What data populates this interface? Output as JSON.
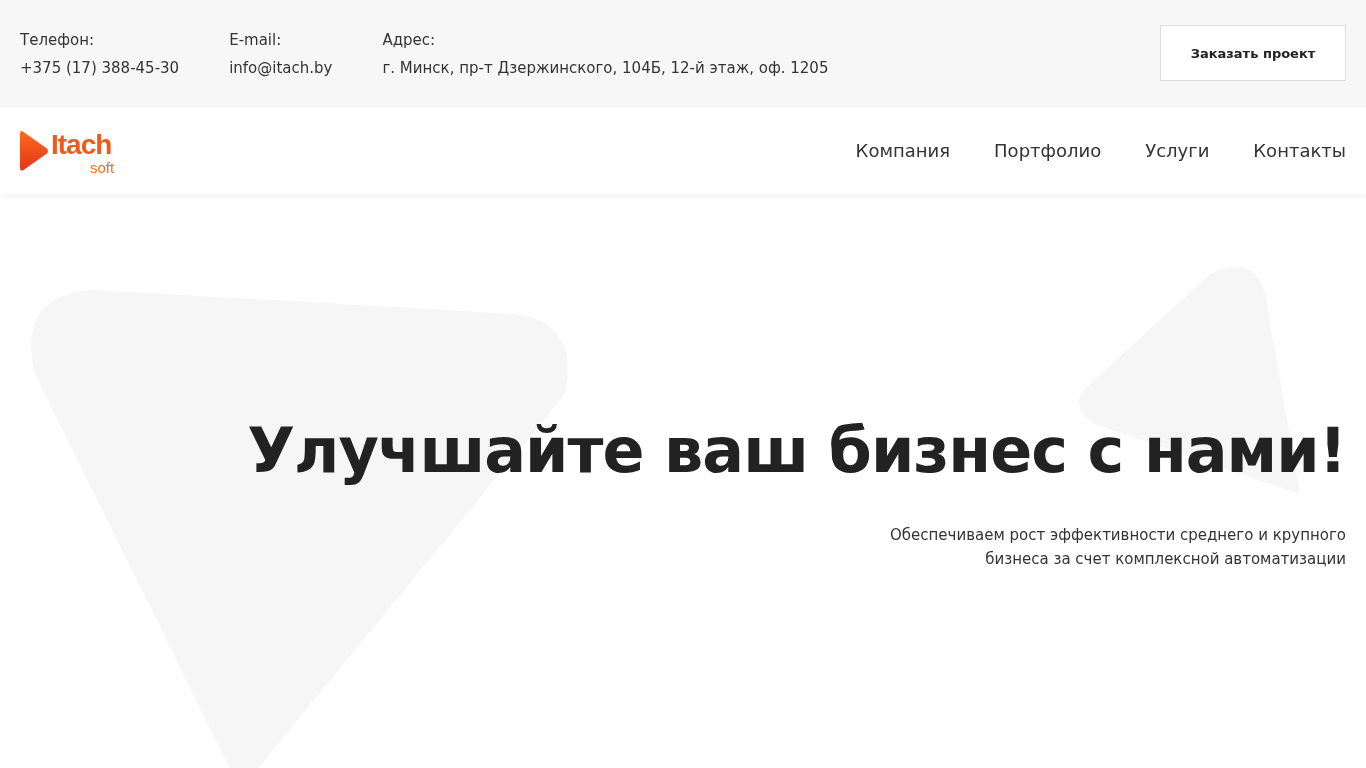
{
  "contacts": [
    {
      "label": "Телефон:",
      "value": "+375 (17) 388-45-30"
    },
    {
      "label": "E-mail:",
      "value": "info@itach.by"
    },
    {
      "label": "Адрес:",
      "value": "г. Минск, пр-т Дзержинского, 104Б, 12-й этаж, оф. 1205"
    }
  ],
  "order_button": "Заказать проект",
  "logo": {
    "name": "Itach",
    "suffix": "soft"
  },
  "nav": [
    "Компания",
    "Портфолио",
    "Услуги",
    "Контакты"
  ],
  "hero": {
    "title": "Улучшайте ваш бизнес с нами!",
    "subtitle": "Обеспечиваем рост эффективности среднего и крупного бизнеса за счет комплексной автоматизации"
  }
}
